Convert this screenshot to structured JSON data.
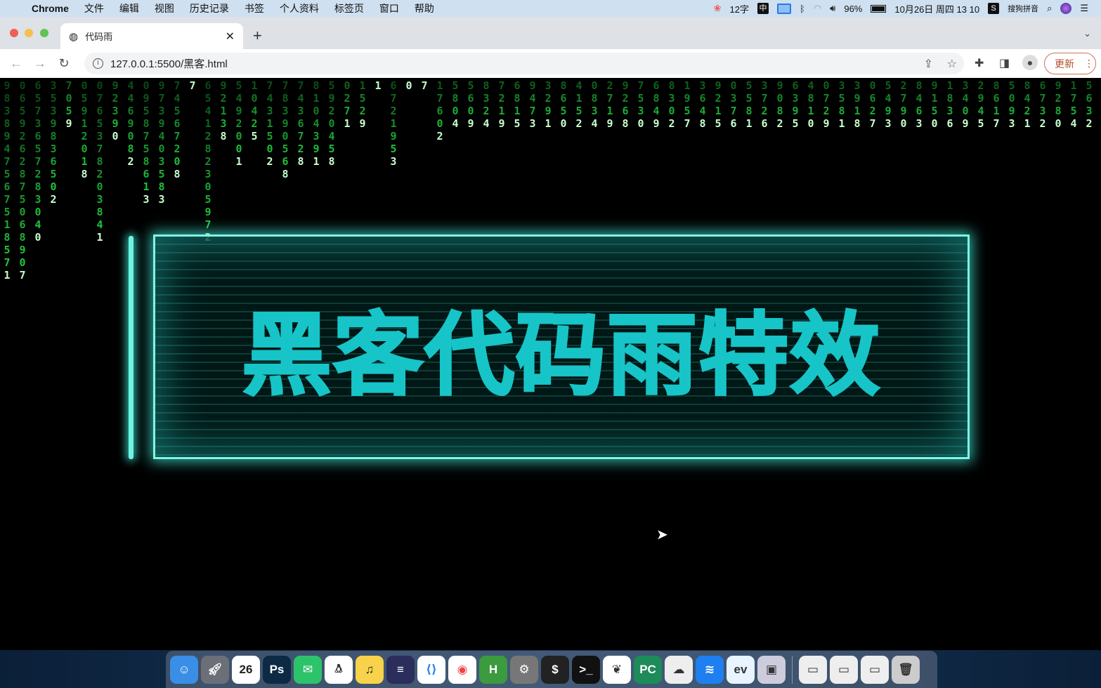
{
  "menubar": {
    "app": "Chrome",
    "items": [
      "文件",
      "编辑",
      "视图",
      "历史记录",
      "书签",
      "个人资料",
      "标签页",
      "窗口",
      "帮助"
    ],
    "word_count": "12字",
    "ime": "中",
    "battery": "96%",
    "datetime": "10月26日 周四 13 10",
    "input_method": "搜狗拼音"
  },
  "browser": {
    "tab_title": "代码雨",
    "url": "127.0.0.1:5500/黑客.html",
    "update_label": "更新"
  },
  "page": {
    "title": "黑客代码雨特效"
  },
  "rain": [
    "9838947567518571",
    "0659262875068907",
    "6573657283040",
    "3539836502",
    "7059",
    "05912018",
    "0765378203841",
    "92390",
    "4469082",
    "0958758613",
    "9739403583",
    "74567208",
    "7",
    "6541282305972",
    "92138",
    "5492001",
    "10425",
    "7431502",
    "78390568",
    "7436728",
    "8104391",
    "5920458",
    "0271",
    "1529",
    "1",
    "6721953",
    "0",
    "7",
    "17602",
    "5804",
    "5609",
    "8324",
    "7219",
    "6815",
    "9473",
    "3291",
    "8650",
    "4152",
    "0834",
    "2719",
    "9268",
    "7530",
    "6849",
    "8302",
    "1957",
    "3648",
    "9215",
    "0376",
    "5581",
    "3726",
    "9082",
    "6395",
    "4810",
    "0729",
    "3581",
    "3918",
    "0627",
    "5493",
    "2790",
    "8463",
    "9150",
    "1836",
    "3409",
    "2945",
    "8617",
    "5093",
    "8421",
    "6732",
    "9280",
    "1754",
    "5632"
  ],
  "dock": [
    "Finder",
    "Launchpad",
    "Calendar",
    "Ps",
    "WeChat",
    "QQ",
    "QQMusic",
    "Eclipse",
    "VS Code",
    "Chrome",
    "HBuilder",
    "Settings",
    "Terminal",
    "iTerm",
    "MongoDB",
    "PyCharm",
    "Messages",
    "Lanhu",
    "Everything",
    "Preview",
    "Window1",
    "Window2",
    "Window3",
    "Trash"
  ],
  "calendar_day": "26",
  "colors": {
    "accent": "#17c4c7",
    "rain": "#22dd44",
    "border": "#7ff5e6"
  }
}
